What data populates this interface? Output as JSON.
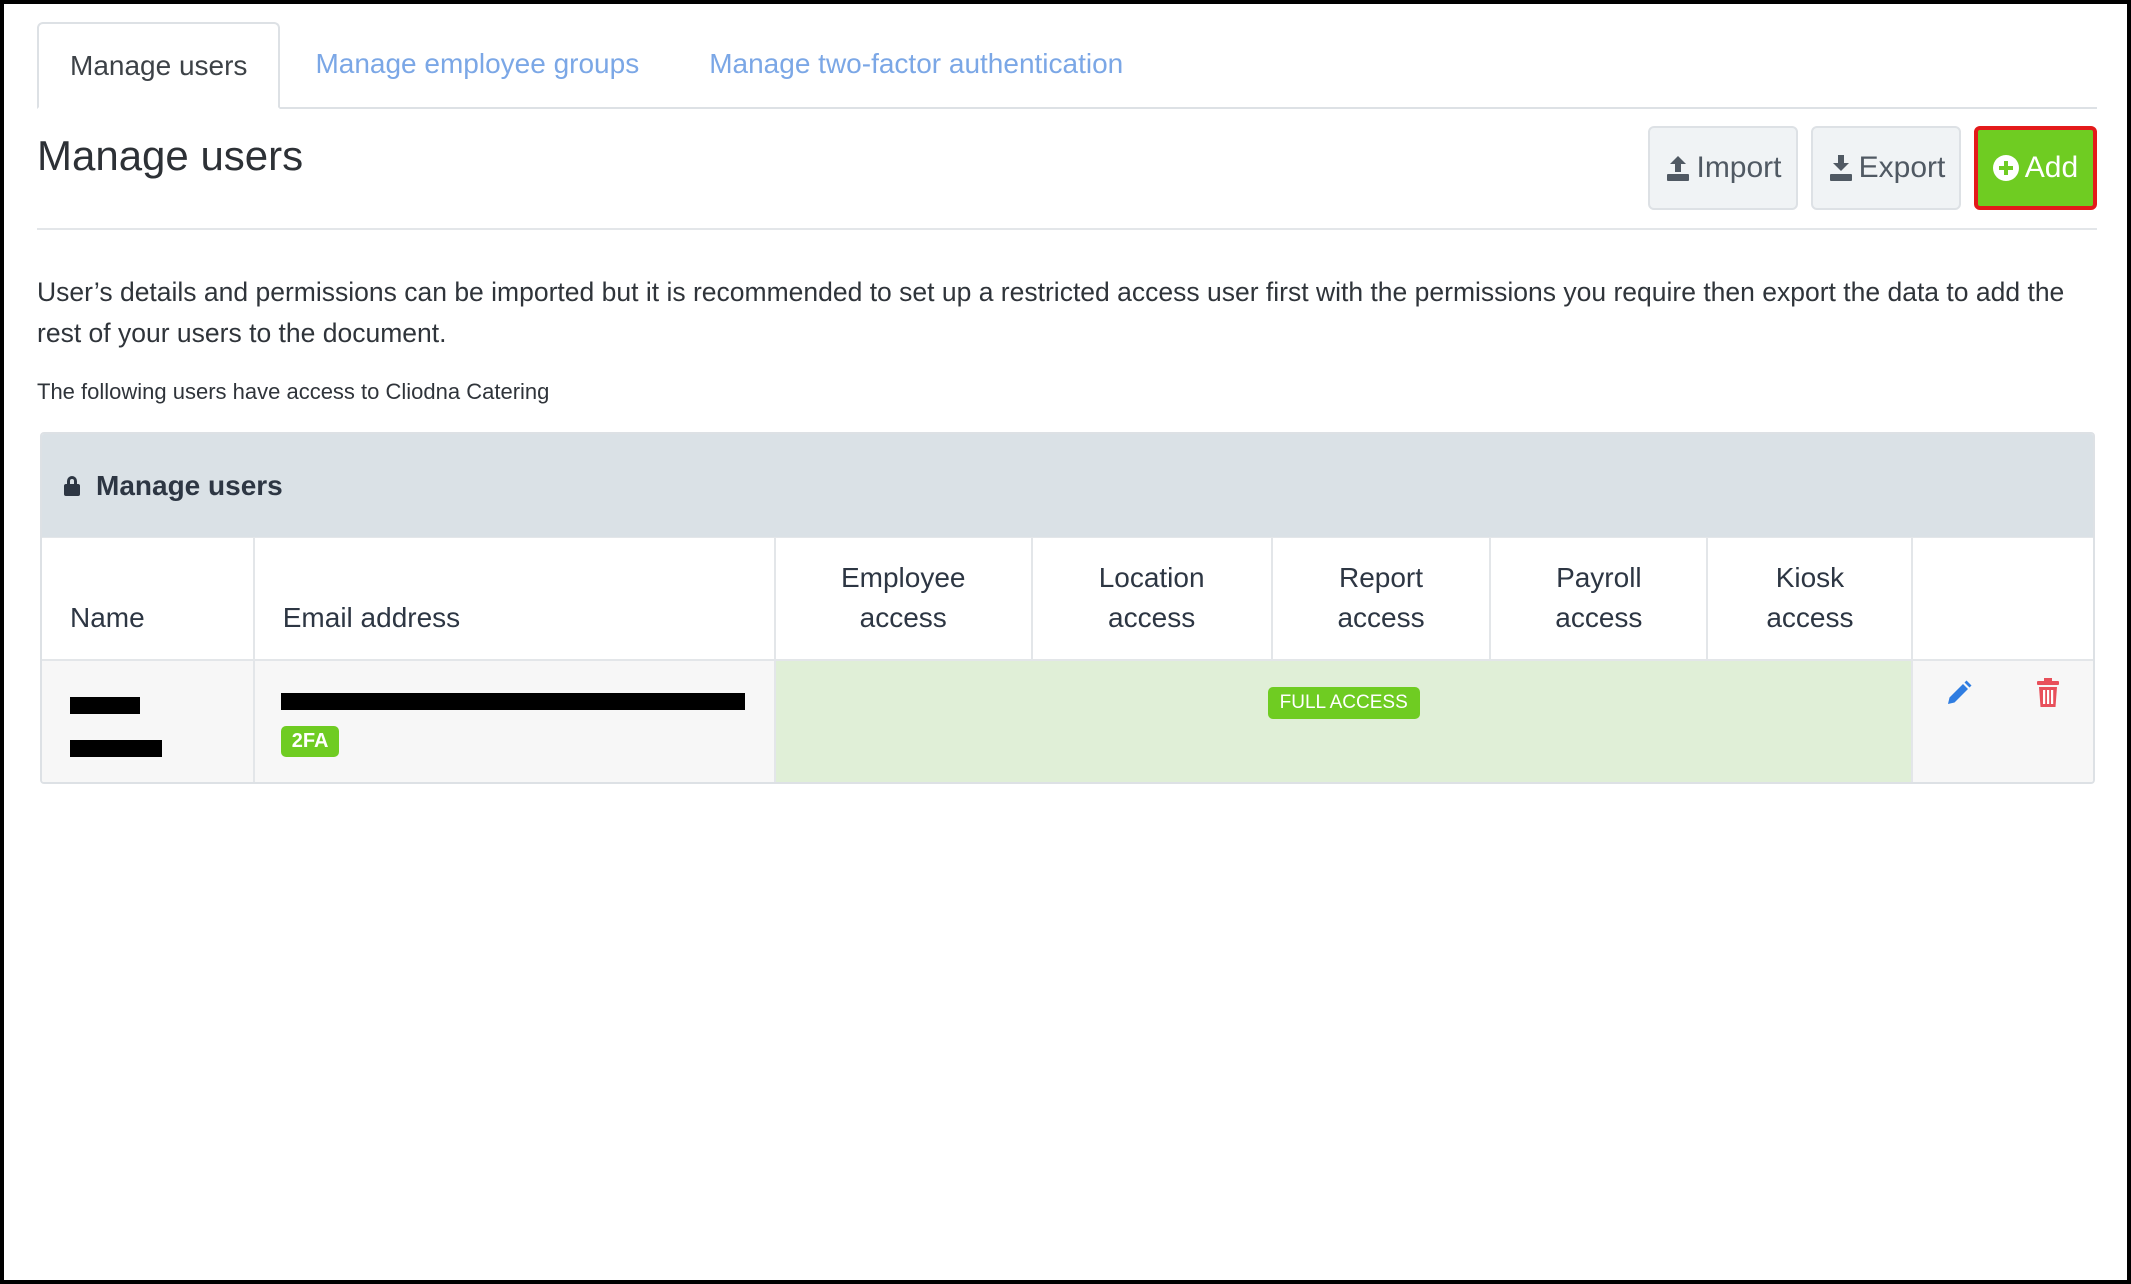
{
  "tabs": [
    {
      "label": "Manage users"
    },
    {
      "label": "Manage employee groups"
    },
    {
      "label": "Manage two-factor authentication"
    }
  ],
  "header": {
    "title": "Manage users",
    "import_label": "Import",
    "export_label": "Export",
    "add_label": "Add"
  },
  "intro": {
    "text": "User’s details and permissions can be imported but it is recommended to set up a restricted access user first with the permissions you require then export the data to add the rest of your users to the document.",
    "subtext": "The following users have access to Cliodna Catering"
  },
  "panel": {
    "title": "Manage users",
    "columns": {
      "name": "Name",
      "email": "Email address",
      "employee_1": "Employee",
      "employee_2": "access",
      "location_1": "Location",
      "location_2": "access",
      "report_1": "Report",
      "report_2": "access",
      "payroll_1": "Payroll",
      "payroll_2": "access",
      "kiosk_1": "Kiosk",
      "kiosk_2": "access"
    },
    "rows": [
      {
        "badge_2fa": "2FA",
        "access": "FULL ACCESS"
      }
    ]
  },
  "colors": {
    "accent_green": "#6fcc22",
    "link_blue": "#7ba7e6",
    "highlight_red": "#e31a1a",
    "edit_blue": "#2f7de1",
    "delete_red": "#e8505b"
  },
  "icons": {
    "lock": "lock-icon",
    "import": "upload-icon",
    "export": "download-icon",
    "add": "plus-circle-icon",
    "edit": "pencil-icon",
    "delete": "trash-icon"
  }
}
